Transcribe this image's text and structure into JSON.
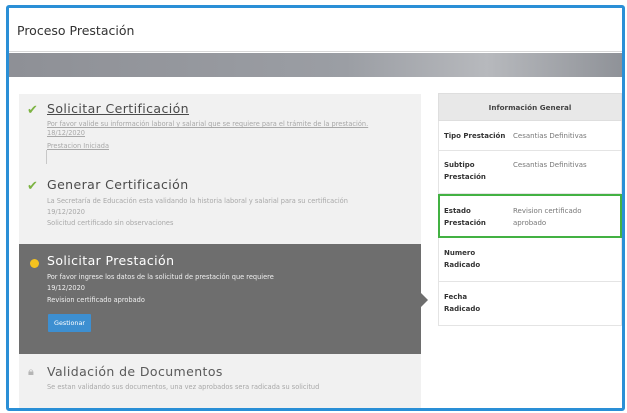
{
  "window": {
    "title": "Proceso Prestación"
  },
  "steps": [
    {
      "title": "Solicitar Certificación",
      "lines": [
        "Por favor valide su información laboral y salarial que se requiere para el trámite de la prestación.",
        "18/12/2020",
        "Prestacion Iniciada"
      ],
      "status": "completed"
    },
    {
      "title": "Generar Certificación",
      "lines": [
        "La Secretaría de Educación esta validando la historia laboral y salarial para su certificación",
        "19/12/2020",
        "Solicitud certificado sin observaciones"
      ],
      "status": "completed"
    },
    {
      "title": "Solicitar Prestación",
      "lines": [
        "Por favor ingrese los datos de la solicitud de prestación que requiere",
        "19/12/2020",
        "Revision certificado aprobado"
      ],
      "button": "Gestionar",
      "status": "active"
    },
    {
      "title": "Validación de Documentos",
      "lines": [
        "Se estan validando sus documentos, una vez aprobados sera radicada su solicitud"
      ],
      "status": "locked"
    }
  ],
  "info": {
    "header": "Información General",
    "rows": [
      {
        "label": "Tipo Prestación",
        "value": "Cesantias Definitivas"
      },
      {
        "label": "Subtipo Prestación",
        "value": "Cesantias Definitivas"
      },
      {
        "label": "Estado Prestación",
        "value": "Revision certificado aprobado"
      },
      {
        "label": "Numero Radicado",
        "value": ""
      },
      {
        "label": "Fecha Radicado",
        "value": ""
      }
    ]
  },
  "colors": {
    "accent_blue": "#2a8fd6",
    "check_green": "#7cb342",
    "active_dot": "#f4c21f",
    "active_bg": "#6e6e6e",
    "highlight_border": "#43b143",
    "button_bg": "#3d8fd1"
  },
  "icons": {
    "completed": "check-icon",
    "active": "dot-icon",
    "locked": "lock-icon"
  }
}
